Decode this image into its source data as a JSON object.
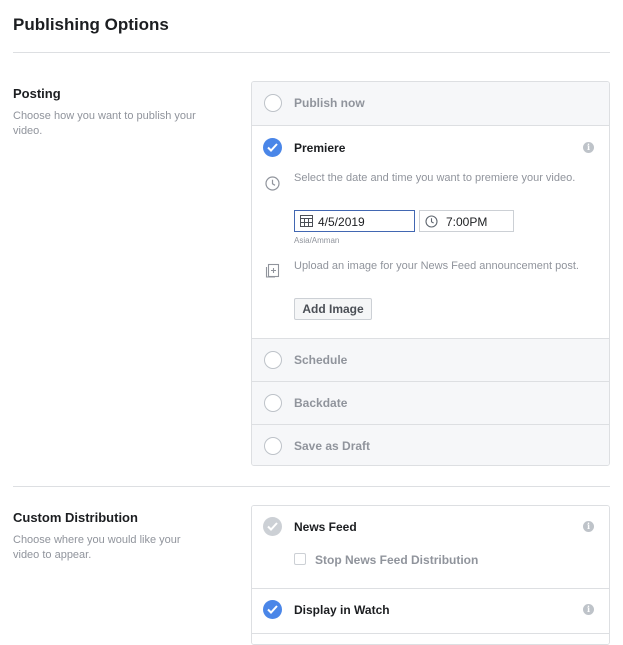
{
  "page": {
    "title": "Publishing Options"
  },
  "posting": {
    "title": "Posting",
    "description": "Choose how you want to publish your video.",
    "publish_now": "Publish now",
    "premiere": {
      "label": "Premiere",
      "date_prompt": "Select the date and time you want to premiere your video.",
      "date": "4/5/2019",
      "time": "7:00PM",
      "timezone": "Asia/Amman",
      "upload_prompt": "Upload an image for your News Feed announcement post.",
      "add_image": "Add Image"
    },
    "schedule": "Schedule",
    "backdate": "Backdate",
    "save_draft": "Save as Draft"
  },
  "distribution": {
    "title": "Custom Distribution",
    "description": "Choose where you would like your video to appear.",
    "news_feed": "News Feed",
    "stop_news_feed": "Stop News Feed Distribution",
    "display_watch": "Display in Watch"
  },
  "colors": {
    "accent": "#4a86e8",
    "muted": "#90949c",
    "border": "#dddfe2",
    "row_bg": "#f6f7f9"
  }
}
